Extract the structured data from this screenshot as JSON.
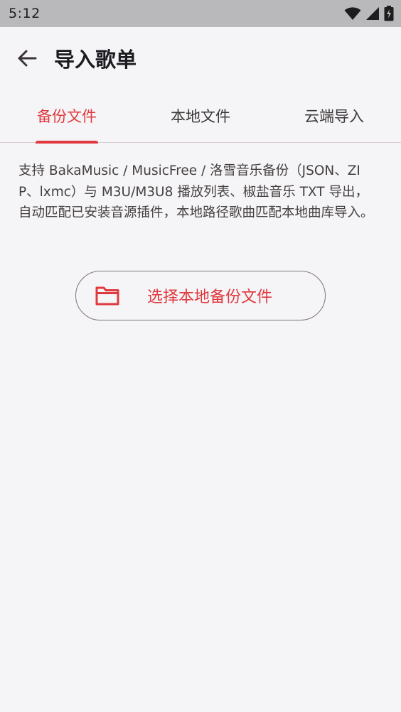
{
  "status_bar": {
    "time": "5:12",
    "icons": [
      "wifi-icon",
      "cell-signal-icon",
      "battery-charging-icon"
    ]
  },
  "app_bar": {
    "back_icon": "arrow-left-icon",
    "title": "导入歌单"
  },
  "tabs": [
    {
      "label": "备份文件",
      "active": true
    },
    {
      "label": "本地文件",
      "active": false
    },
    {
      "label": "云端导入",
      "active": false
    }
  ],
  "main": {
    "description": "支持 BakaMusic / MusicFree / 洛雪音乐备份（JSON、ZIP、lxmc）与 M3U/M3U8 播放列表、椒盐音乐 TXT 导出，自动匹配已安装音源插件，本地路径歌曲匹配本地曲库导入。",
    "pick_button": {
      "icon": "folder-icon",
      "label": "选择本地备份文件"
    }
  },
  "colors": {
    "accent": "#e0393e",
    "background": "#f5f4f7",
    "status_bar": "#b9b9bb"
  }
}
